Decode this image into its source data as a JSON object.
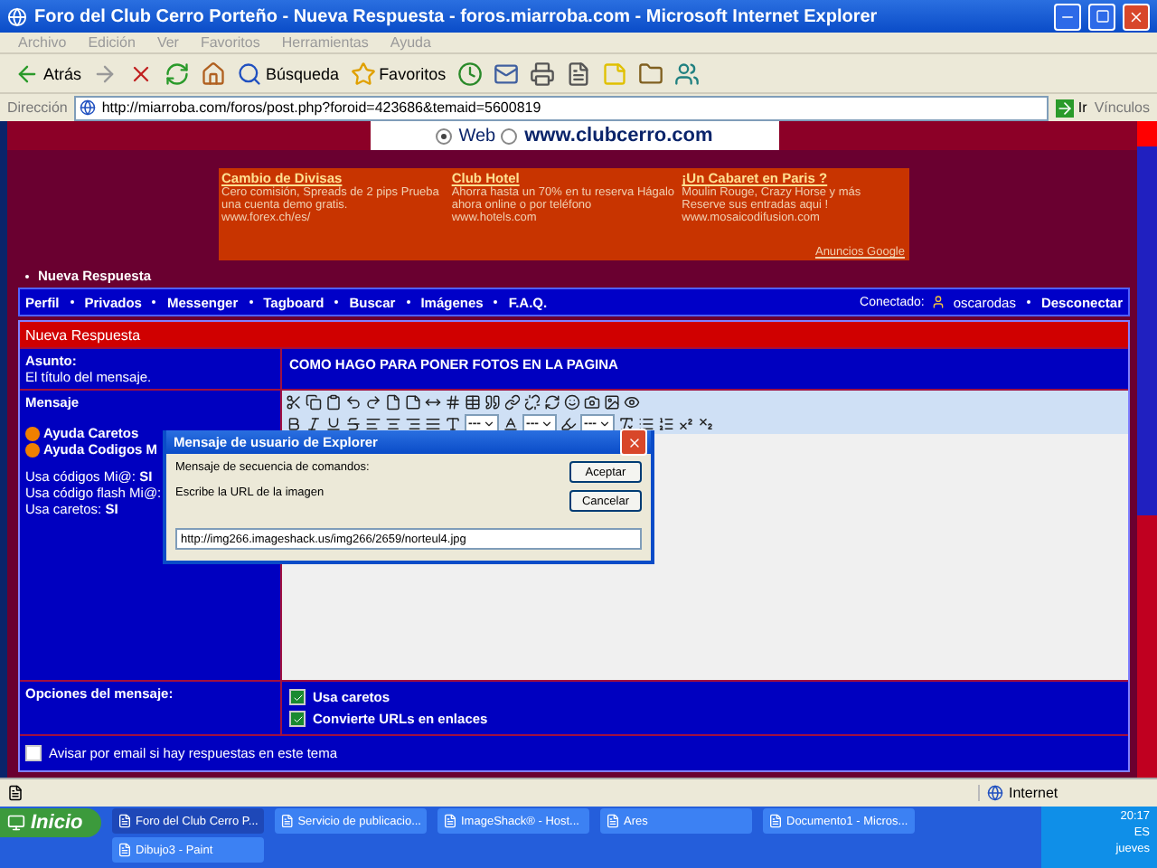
{
  "window": {
    "title": "Foro del Club Cerro Porteño - Nueva Respuesta - foros.miarroba.com - Microsoft Internet Explorer"
  },
  "menu": [
    "Archivo",
    "Edición",
    "Ver",
    "Favoritos",
    "Herramientas",
    "Ayuda"
  ],
  "toolbar": {
    "back": "Atrás",
    "search": "Búsqueda",
    "favorites": "Favoritos"
  },
  "address": {
    "label": "Dirección",
    "url": "http://miarroba.com/foros/post.php?foroid=423686&temaid=5600819",
    "go": "Ir",
    "links": "Vínculos"
  },
  "search_box": {
    "options": [
      {
        "label": "Web",
        "selected": true
      },
      {
        "label": "www.clubcerro.com",
        "selected": false
      }
    ]
  },
  "ads": {
    "items": [
      {
        "title": "Cambio de Divisas",
        "text": "Cero comisión, Spreads de 2 pips Prueba una cuenta demo gratis.",
        "url": "www.forex.ch/es/"
      },
      {
        "title": "Club Hotel",
        "text": "Ahorra hasta un 70% en tu reserva Hágalo ahora online o por teléfono",
        "url": "www.hotels.com"
      },
      {
        "title": "¡Un Cabaret en Paris ?",
        "text": "Moulin Rouge, Crazy Horse y más Reserve sus entradas aqui !",
        "url": "www.mosaicodifusion.com"
      }
    ],
    "footer": "Anuncios Google"
  },
  "breadcrumb": "Nueva Respuesta",
  "nav": {
    "items": [
      "Perfil",
      "Privados",
      "Messenger",
      "Tagboard",
      "Buscar",
      "Imágenes",
      "F.A.Q."
    ],
    "connected_label": "Conectado:",
    "user": "oscarodas",
    "logout": "Desconectar"
  },
  "form": {
    "header": "Nueva Respuesta",
    "subject": {
      "label": "Asunto:",
      "hint": "El título del mensaje.",
      "value": "COMO HAGO PARA PONER FOTOS EN LA PAGINA"
    },
    "message": {
      "label": "Mensaje",
      "help_links": [
        "Ayuda Caretos",
        "Ayuda Codigos M"
      ],
      "info": [
        "Usa códigos Mi@: **SI**",
        "Usa código flash Mi@:",
        "Usa caretos: **SI**"
      ]
    },
    "editor": {
      "selects": [
        "---",
        "---",
        "---"
      ]
    },
    "options": {
      "label": "Opciones del mensaje:",
      "checkboxes": [
        {
          "label": "Usa caretos",
          "checked": true
        },
        {
          "label": "Convierte URLs en enlaces",
          "checked": true
        }
      ]
    },
    "notify": {
      "label": "Avisar por email si hay respuestas en este tema",
      "checked": false
    }
  },
  "status_bar": {
    "zone": "Internet"
  },
  "taskbar": {
    "start": "Inicio",
    "tasks": [
      {
        "label": "Foro del Club Cerro P...",
        "selected": true
      },
      {
        "label": "Servicio de publicacio...",
        "selected": false
      },
      {
        "label": "ImageShack® - Host...",
        "selected": false
      },
      {
        "label": "Ares",
        "selected": false
      },
      {
        "label": "Documento1 - Micros...",
        "selected": false
      },
      {
        "label": "Dibujo3 - Paint",
        "selected": false
      }
    ],
    "language": "ES",
    "time": "20:17",
    "day": "jueves"
  },
  "dialog": {
    "title": "Mensaje de usuario de Explorer",
    "message": "Mensaje de secuencia de comandos:",
    "prompt": "Escribe la URL de la imagen",
    "value": "http://img266.imageshack.us/img266/2659/norteul4.jpg",
    "buttons": [
      "Aceptar",
      "Cancelar"
    ]
  }
}
